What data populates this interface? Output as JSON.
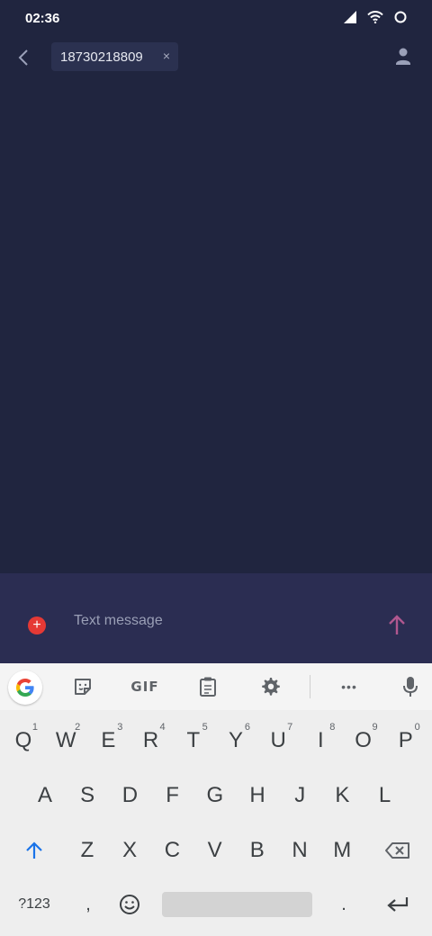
{
  "status_bar": {
    "time": "02:36",
    "icons": [
      "signal-icon",
      "wifi-icon",
      "circle-icon"
    ]
  },
  "header": {
    "recipient": "18730218809",
    "chip_close": "×"
  },
  "compose": {
    "placeholder": "Text message",
    "attach_symbol": "+"
  },
  "keyboard": {
    "toolbar": {
      "gif_label": "GIF",
      "more_label": "•••"
    },
    "row1": [
      {
        "key": "Q",
        "hint": "1"
      },
      {
        "key": "W",
        "hint": "2"
      },
      {
        "key": "E",
        "hint": "3"
      },
      {
        "key": "R",
        "hint": "4"
      },
      {
        "key": "T",
        "hint": "5"
      },
      {
        "key": "Y",
        "hint": "6"
      },
      {
        "key": "U",
        "hint": "7"
      },
      {
        "key": "I",
        "hint": "8"
      },
      {
        "key": "O",
        "hint": "9"
      },
      {
        "key": "P",
        "hint": "0"
      }
    ],
    "row2": [
      "A",
      "S",
      "D",
      "F",
      "G",
      "H",
      "J",
      "K",
      "L"
    ],
    "row3": [
      "Z",
      "X",
      "C",
      "V",
      "B",
      "N",
      "M"
    ],
    "row4": {
      "symbols_label": "?123",
      "comma": ",",
      "period": "."
    }
  },
  "colors": {
    "background": "#20253f",
    "compose_bar": "#2b2d52",
    "attach_red": "#e53935",
    "send_pink": "#b0578f",
    "shift_blue": "#1a73e8"
  }
}
